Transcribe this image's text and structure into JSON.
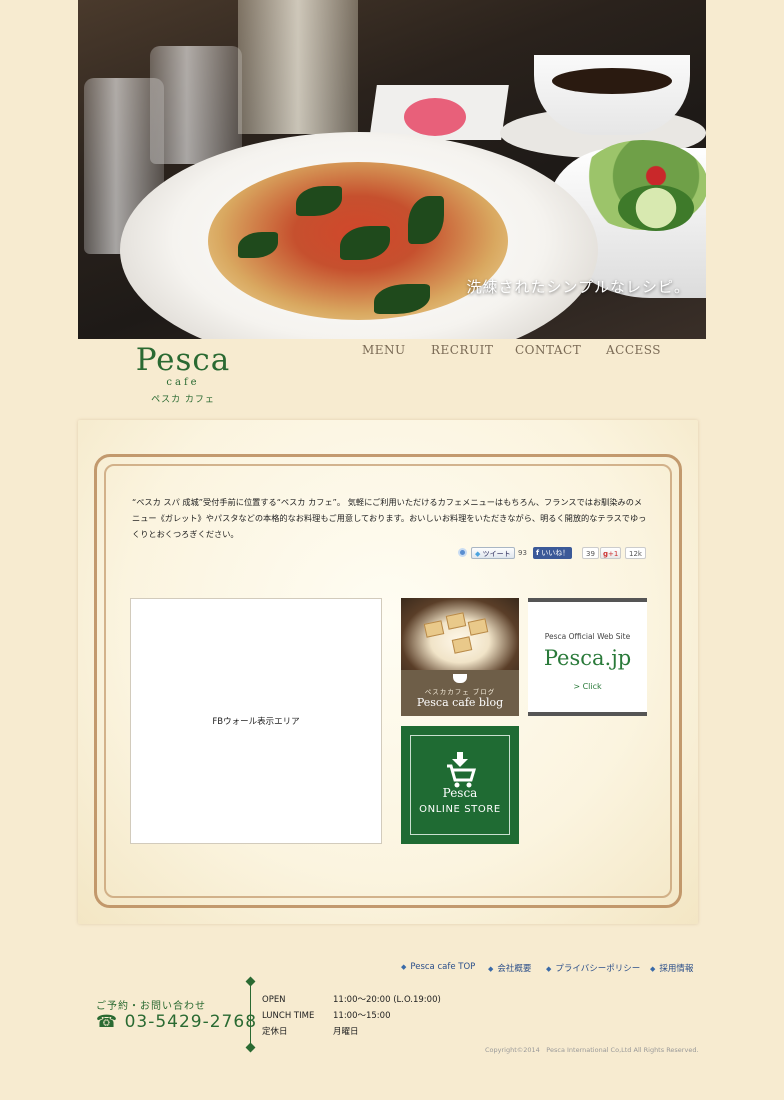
{
  "hero": {
    "caption": "洗練されたシンプルなレシピ。"
  },
  "header": {
    "logo_word": "Pesca",
    "logo_sub": "cafe",
    "logo_kana": "ペスカ カフェ",
    "nav": [
      "MENU",
      "RECRUIT",
      "CONTACT",
      "ACCESS"
    ]
  },
  "intro": {
    "text": "“ペスカ スパ 成城”受付手前に位置する“ペスカ カフェ”。 気軽にご利用いただけるカフェメニューはもちろん、フランスではお馴染みのメニュー《ガレット》やパスタなどの本格的なお料理もご用意しております。おいしいお料理をいただきながら、明るく開放的なテラスでゆっくりとおくつろぎください。"
  },
  "social": {
    "tweet_label": "ツイート",
    "tweet_count": "93",
    "like_label": "いいね！",
    "like_count": "39",
    "plusone_label": "+1",
    "plusone_count": "12k"
  },
  "fb_wall": {
    "label": "FBウォール表示エリア"
  },
  "blog_banner": {
    "jp": "ペスカカフェ ブログ",
    "en": "Pesca cafe blog"
  },
  "official_banner": {
    "small": "Pesca Official Web Site",
    "big": "Pesca.jp",
    "click": "> Click"
  },
  "store_banner": {
    "line1": "Pesca",
    "line2": "ONLINE STORE"
  },
  "footer": {
    "links": [
      "Pesca cafe TOP",
      "会社概要",
      "プライバシーポリシー",
      "採用情報"
    ],
    "contact_label": "ご予約・お問い合わせ",
    "phone": "☎ 03-5429-2768",
    "hours": [
      {
        "label": "OPEN",
        "value": "11:00～20:00 (L.O.19:00)"
      },
      {
        "label": "LUNCH TIME",
        "value": "11:00～15:00"
      },
      {
        "label": "定休日",
        "value": "月曜日"
      }
    ],
    "copyright": "Copyright©2014　Pesca International Co,Ltd All Rights Reserved."
  },
  "colors": {
    "page_bg": "#f7ebd0",
    "brand_green": "#2a6a32",
    "store_green": "#1f6b33",
    "frame_brown": "#b8895a",
    "link_blue": "#2b4f8a"
  }
}
